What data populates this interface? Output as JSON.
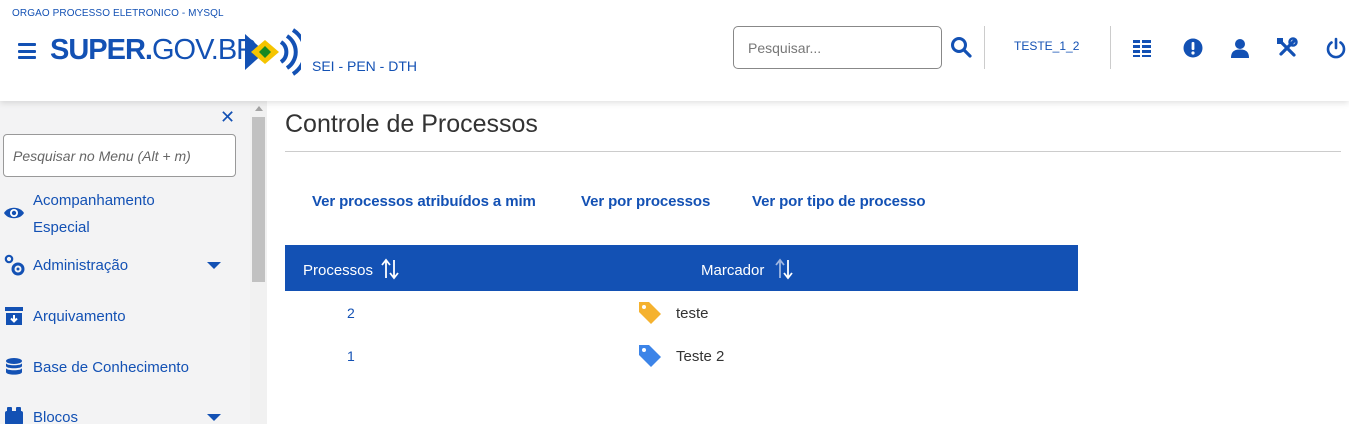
{
  "header": {
    "org_label": "ORGAO PROCESSO ELETRONICO - MYSQL",
    "logo_bold": "SUPER.",
    "logo_light": "GOV.BR",
    "subtitle": "SEI - PEN - DTH",
    "search_placeholder": "Pesquisar...",
    "user": "TESTE_1_2",
    "icons": [
      "menu-icon",
      "search-icon",
      "list-icon",
      "alert-icon",
      "user-icon",
      "tools-icon",
      "power-icon"
    ],
    "brand_color": "#1351b4"
  },
  "sidebar": {
    "search_placeholder": "Pesquisar no Menu (Alt + m)",
    "items": [
      {
        "label_line1": "Acompanhamento",
        "label_line2": "Especial",
        "icon": "eye-icon",
        "has_submenu": false
      },
      {
        "label": "Administração",
        "icon": "gears-icon",
        "has_submenu": true
      },
      {
        "label": "Arquivamento",
        "icon": "archive-icon",
        "has_submenu": false
      },
      {
        "label": "Base de Conhecimento",
        "icon": "database-icon",
        "has_submenu": false
      },
      {
        "label": "Blocos",
        "icon": "blocks-icon",
        "has_submenu": true
      }
    ]
  },
  "main": {
    "title": "Controle de Processos",
    "view_links": [
      "Ver processos atribuídos a mim",
      "Ver por processos",
      "Ver por tipo de processo"
    ],
    "table": {
      "columns": [
        "Processos",
        "Marcador"
      ],
      "header_color": "#1351b4",
      "rows": [
        {
          "processos": "2",
          "marcador": "teste",
          "tag_color": "#f5b22f"
        },
        {
          "processos": "1",
          "marcador": "Teste 2",
          "tag_color": "#3c84e8"
        }
      ]
    }
  }
}
